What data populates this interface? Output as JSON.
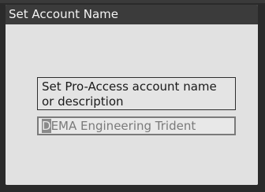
{
  "window": {
    "title": "Set Account Name"
  },
  "prompt": {
    "line1": "Set Pro-Access account name",
    "line2": "or description"
  },
  "name_field": {
    "cursor_char": "D",
    "rest": "EMA Engineering Trident"
  },
  "colors": {
    "titlebar": "#3b3b3b",
    "screen_background": "#e1e1e1",
    "bezel": "#2a2a2a"
  }
}
